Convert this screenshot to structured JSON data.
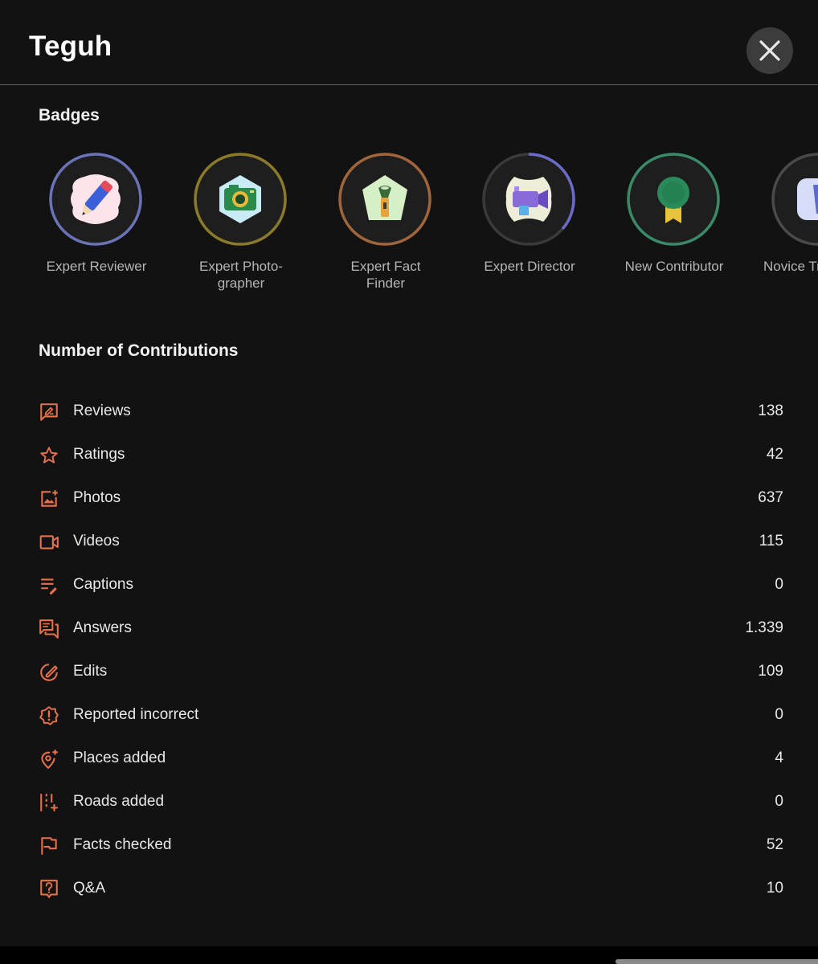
{
  "header": {
    "title": "Teguh"
  },
  "colors": {
    "accent": "#e8704a",
    "background": "#121212"
  },
  "badges": {
    "title": "Badges",
    "items": [
      {
        "label": "Expert Reviewer",
        "icon": "pen-badge-icon",
        "ring_color": "#6b73b8",
        "bg": "#fde3ea"
      },
      {
        "label": "Expert Photo-\ngrapher",
        "icon": "camera-badge-icon",
        "ring_color": "#8a7a2a",
        "bg": "#c8ecf5"
      },
      {
        "label": "Expert Fact\nFinder",
        "icon": "flashlight-badge-icon",
        "ring_color": "#a0653a",
        "bg": "#d7efc6"
      },
      {
        "label": "Expert Director",
        "icon": "video-camera-badge-icon",
        "ring_color": "#6b6bc8",
        "bg": "#eeeed8"
      },
      {
        "label": "New Contributor",
        "icon": "ribbon-badge-icon",
        "ring_color": "#3a8a6a",
        "bg": "#1e1e1e"
      },
      {
        "label": "Novice Tr",
        "icon": "road-badge-icon",
        "ring_color": "#4a4a4a",
        "bg": "#d7dcf8"
      }
    ]
  },
  "contributions": {
    "title": "Number of Contributions",
    "items": [
      {
        "label": "Reviews",
        "count": "138",
        "icon": "review-icon"
      },
      {
        "label": "Ratings",
        "count": "42",
        "icon": "star-icon"
      },
      {
        "label": "Photos",
        "count": "637",
        "icon": "add-photo-icon"
      },
      {
        "label": "Videos",
        "count": "115",
        "icon": "video-icon"
      },
      {
        "label": "Captions",
        "count": "0",
        "icon": "caption-edit-icon"
      },
      {
        "label": "Answers",
        "count": "1.339",
        "icon": "answers-icon"
      },
      {
        "label": "Edits",
        "count": "109",
        "icon": "edit-tag-icon"
      },
      {
        "label": "Reported incorrect",
        "count": "0",
        "icon": "report-icon"
      },
      {
        "label": "Places added",
        "count": "4",
        "icon": "add-location-icon"
      },
      {
        "label": "Roads added",
        "count": "0",
        "icon": "add-road-icon"
      },
      {
        "label": "Facts checked",
        "count": "52",
        "icon": "flag-icon"
      },
      {
        "label": "Q&A",
        "count": "10",
        "icon": "question-icon"
      }
    ]
  }
}
